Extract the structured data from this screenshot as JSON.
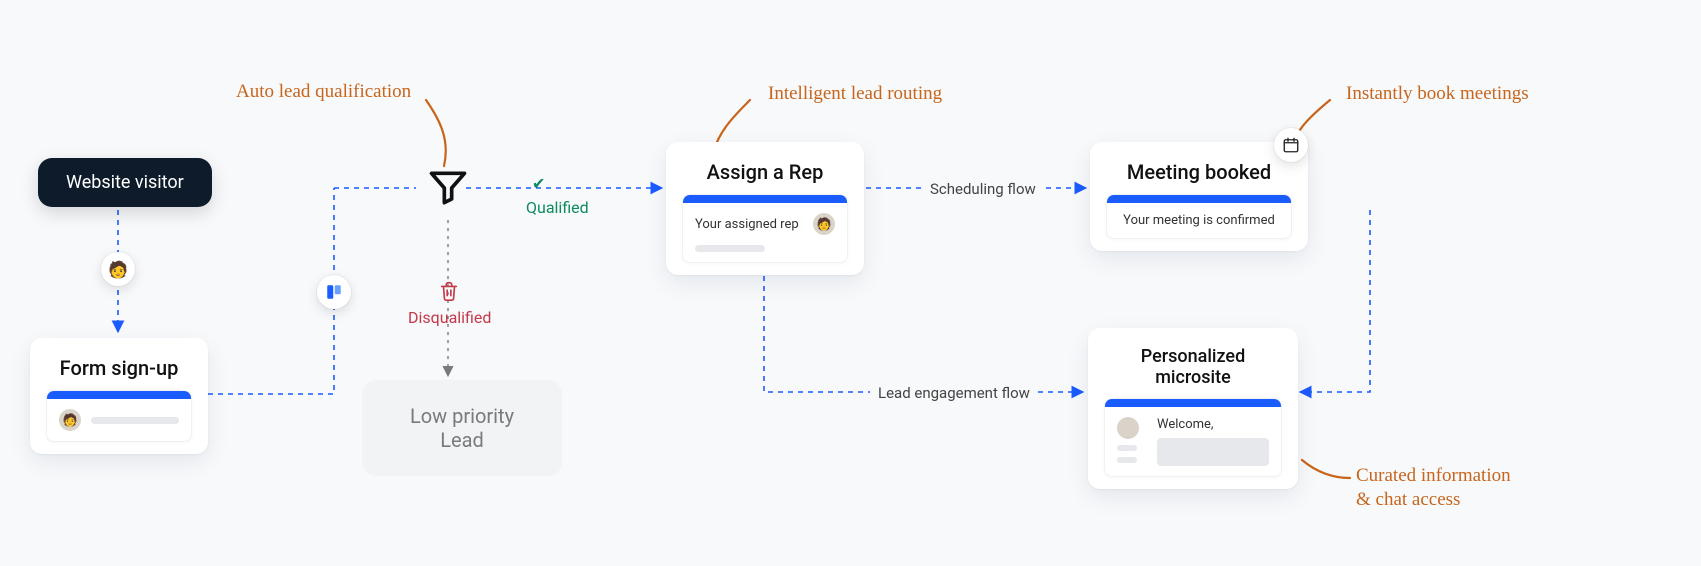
{
  "annotations": {
    "qualification": "Auto lead qualification",
    "routing": "Intelligent lead routing",
    "booking": "Instantly book meetings",
    "microsite": "Curated information\n& chat access"
  },
  "nodes": {
    "visitor": {
      "label": "Website visitor"
    },
    "form": {
      "title": "Form sign-up"
    },
    "lowPriority": {
      "title": "Low priority Lead"
    },
    "assign": {
      "title": "Assign a Rep",
      "panelText": "Your assigned rep"
    },
    "meeting": {
      "title": "Meeting booked",
      "panelText": "Your meeting is confirmed"
    },
    "microsite": {
      "title": "Personalized microsite",
      "welcome": "Welcome,"
    }
  },
  "edges": {
    "qualified": "Qualified",
    "disqualified": "Disqualified",
    "scheduling": "Scheduling flow",
    "engagement": "Lead engagement flow"
  },
  "icons": {
    "funnel": "funnel-icon",
    "trash": "trash-icon",
    "check": "check-icon",
    "form": "form-icon",
    "calendar": "calendar-icon",
    "avatar": "avatar-icon"
  },
  "colors": {
    "accent": "#1b5cff",
    "hand": "#c8651b",
    "ok": "#0f8a5f",
    "bad": "#c53a4b",
    "darkNode": "#0d1b2a"
  }
}
